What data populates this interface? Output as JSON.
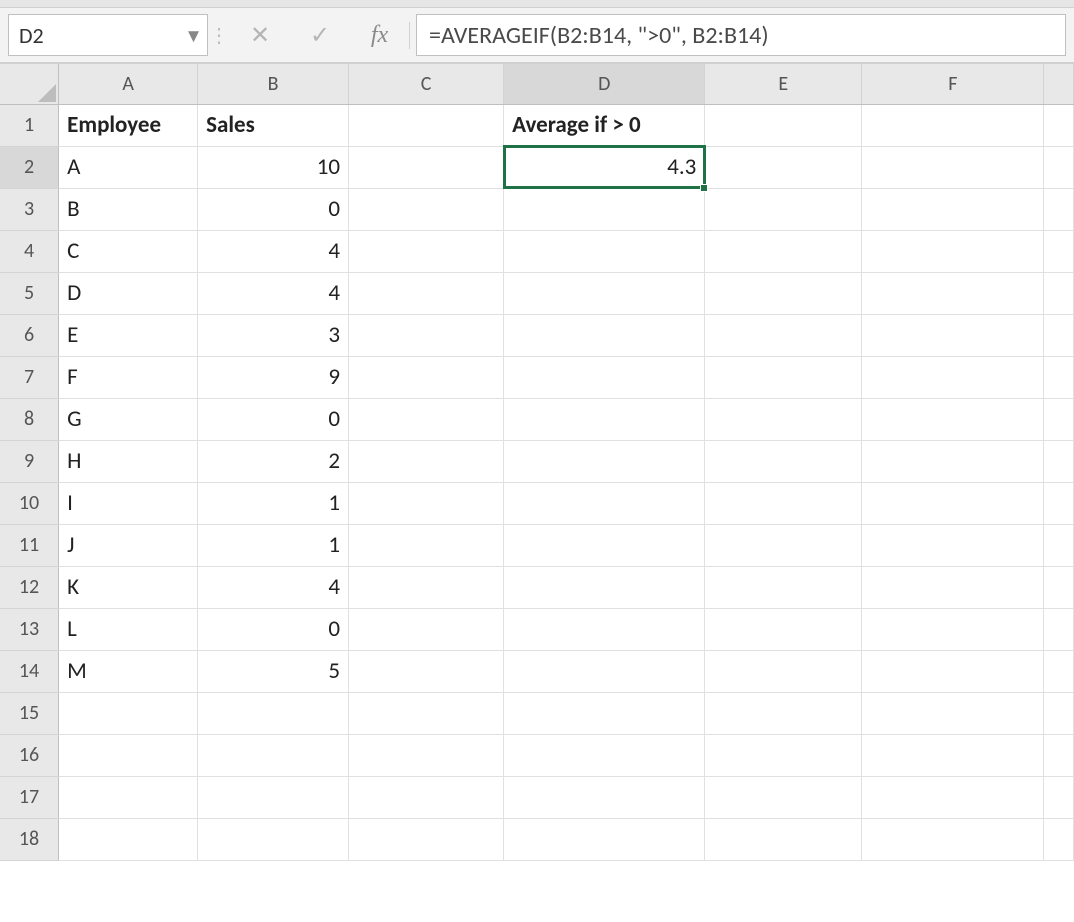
{
  "nameBox": "D2",
  "formula": "=AVERAGEIF(B2:B14, \">0\", B2:B14)",
  "columns": [
    "A",
    "B",
    "C",
    "D",
    "E",
    "F"
  ],
  "selectedCol": "D",
  "selectedRow": 2,
  "visibleRows": 18,
  "headers": {
    "A1": "Employee",
    "B1": "Sales",
    "D1": "Average if > 0"
  },
  "data": {
    "employees": [
      "A",
      "B",
      "C",
      "D",
      "E",
      "F",
      "G",
      "H",
      "I",
      "J",
      "K",
      "L",
      "M"
    ],
    "sales": [
      10,
      0,
      4,
      4,
      3,
      9,
      0,
      2,
      1,
      1,
      4,
      0,
      5
    ],
    "avgResult": "4.3"
  },
  "icons": {
    "dropdown": "▾",
    "cancel": "✕",
    "confirm": "✓",
    "fx": "fx",
    "vdots": "⋮"
  }
}
